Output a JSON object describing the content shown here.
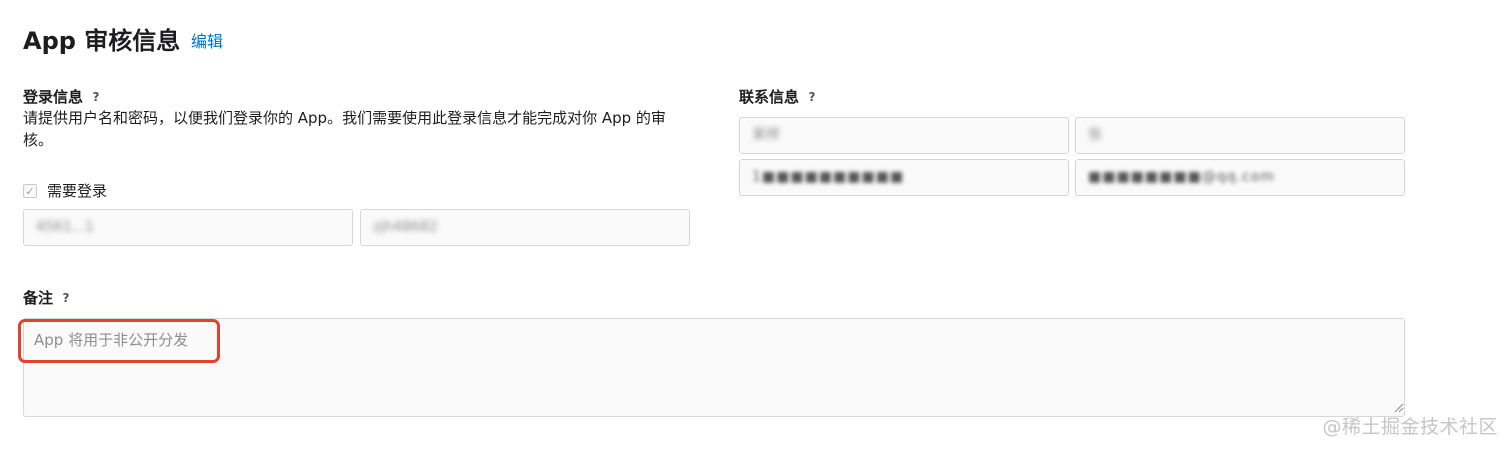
{
  "header": {
    "title": "App 审核信息",
    "edit_label": "编辑"
  },
  "login": {
    "label": "登录信息",
    "help": "?",
    "description": "请提供用户名和密码，以便我们登录你的 App。我们需要使用此登录信息才能完成对你 App 的审核。",
    "requires_login_label": "需要登录",
    "requires_login_checked": true,
    "check_mark": "✓",
    "username_value": "4561...1",
    "password_value": "zjh48682"
  },
  "contact": {
    "label": "联系信息",
    "help": "?",
    "first_name": "某样",
    "last_name": "张",
    "phone": "1■■■■■■■■■■",
    "email": "■■■■■■■■@qq.com"
  },
  "notes": {
    "label": "备注",
    "help": "?",
    "value": "App 将用于非公开分发"
  },
  "watermark": "@稀土掘金技术社区",
  "colors": {
    "link": "#0070c9",
    "highlight": "#e0432c",
    "field_bg": "#fafafa",
    "field_border": "#d6d6d6"
  }
}
